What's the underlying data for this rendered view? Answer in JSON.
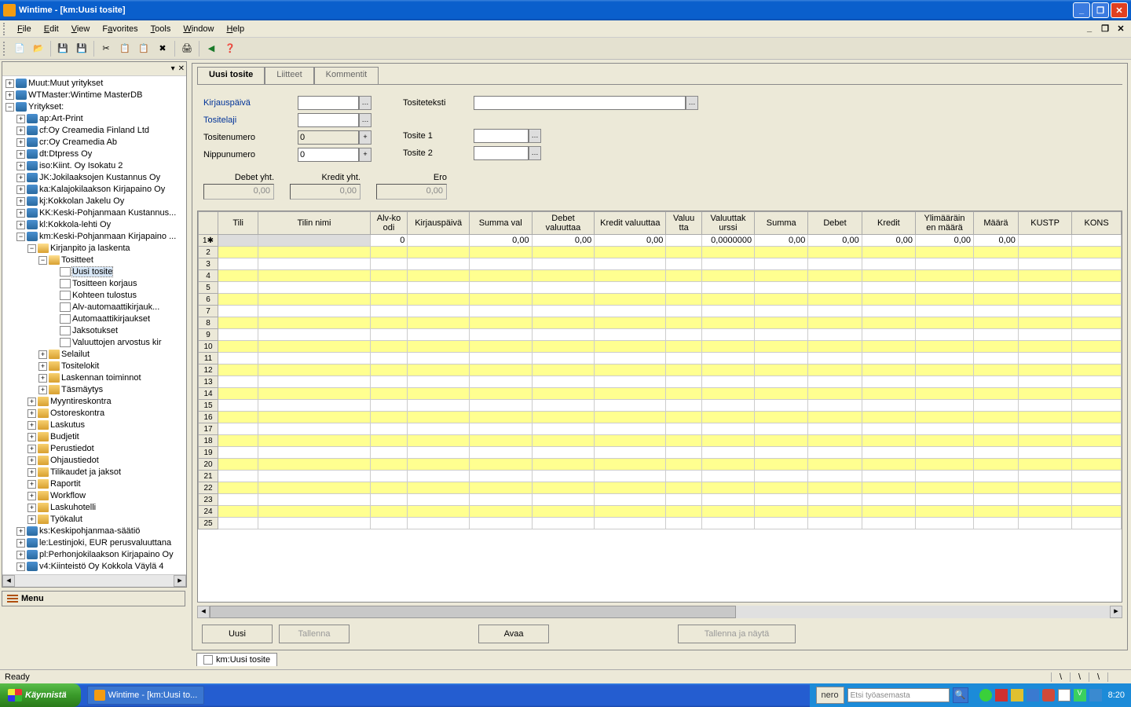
{
  "window": {
    "title": "Wintime - [km:Uusi tosite]"
  },
  "menubar": [
    "File",
    "Edit",
    "View",
    "Favorites",
    "Tools",
    "Window",
    "Help"
  ],
  "tree": {
    "roots": [
      {
        "label": "Muut:Muut yritykset",
        "exp": "+",
        "ico": "db"
      },
      {
        "label": "WTMaster:Wintime MasterDB",
        "exp": "+",
        "ico": "db"
      }
    ],
    "companies_label": "Yritykset:",
    "companies": [
      "ap:Art-Print",
      "cf:Oy Creamedia Finland Ltd",
      "cr:Oy Creamedia Ab",
      "dt:Dtpress Oy",
      "iso:Kiint. Oy Isokatu 2",
      "JK:Jokilaaksojen Kustannus Oy",
      "ka:Kalajokilaakson Kirjapaino Oy",
      "kj:Kokkolan Jakelu Oy",
      "KK:Keski-Pohjanmaan Kustannus...",
      "kl:Kokkola-lehti Oy"
    ],
    "km_label": "km:Keski-Pohjanmaan Kirjapaino ...",
    "km_open": "Kirjanpito ja laskenta",
    "tositteet_label": "Tositteet",
    "tositteet": [
      "Uusi tosite",
      "Tositteen korjaus",
      "Kohteen tulostus",
      "Alv-automaattikirjauk...",
      "Automaattikirjaukset",
      "Jaksotukset",
      "Valuuttojen arvostus kir"
    ],
    "km_siblings": [
      "Selailut",
      "Tositelokit",
      "Laskennan toiminnot",
      "Täsmäytys"
    ],
    "km_modules": [
      "Myyntireskontra",
      "Ostoreskontra",
      "Laskutus",
      "Budjetit",
      "Perustiedot",
      "Ohjaustiedot",
      "Tilikaudet ja jaksot",
      "Raportit",
      "Workflow",
      "Laskuhotelli",
      "Työkalut"
    ],
    "rest": [
      "ks:Keskipohjanmaa-säätiö",
      "le:Lestinjoki, EUR perusvaluuttana",
      "pl:Perhonjokilaakson Kirjapaino Oy",
      "v4:Kiinteistö Oy Kokkola Väylä 4"
    ]
  },
  "menu_button": "Menu",
  "tabs": {
    "active": "Uusi tosite",
    "others": [
      "Liitteet",
      "Kommentit"
    ]
  },
  "form": {
    "kirjauspaiva": "Kirjauspäivä",
    "tositelaji": "Tositelaji",
    "tositenumero": "Tositenumero",
    "nippunumero": "Nippunumero",
    "nippunumero_val": "0",
    "tositenumero_val": "0",
    "tositeteksti": "Tositeteksti",
    "tosite1": "Tosite 1",
    "tosite2": "Tosite 2",
    "debet_label": "Debet yht.",
    "kredit_label": "Kredit yht.",
    "ero_label": "Ero",
    "zero": "0,00"
  },
  "grid": {
    "headers": [
      "Tili",
      "Tilin nimi",
      "Alv-ko odi",
      "Kirjauspäivä",
      "Summa val",
      "Debet valuuttaa",
      "Kredit valuuttaa",
      "Valuu tta",
      "Valuuttak urssi",
      "Summa",
      "Debet",
      "Kredit",
      "Ylimääräin en määrä",
      "Määrä",
      "KUSTP",
      "KONS"
    ],
    "first_row": {
      "alv": "0",
      "s1": "0,00",
      "s2": "0,00",
      "s3": "0,00",
      "kurssi": "0,0000000",
      "s4": "0,00",
      "s5": "0,00",
      "s6": "0,00",
      "s7": "0,00",
      "s8": "0,00"
    }
  },
  "buttons": {
    "uusi": "Uusi",
    "tallenna": "Tallenna",
    "avaa": "Avaa",
    "tallenna_nayta": "Tallenna ja näytä"
  },
  "doc_tab": "km:Uusi tosite",
  "status": "Ready",
  "taskbar": {
    "start": "Käynnistä",
    "app": "Wintime - [km:Uusi to...",
    "search": "Etsi työasemasta",
    "clock": "8:20",
    "nero": "nero"
  }
}
